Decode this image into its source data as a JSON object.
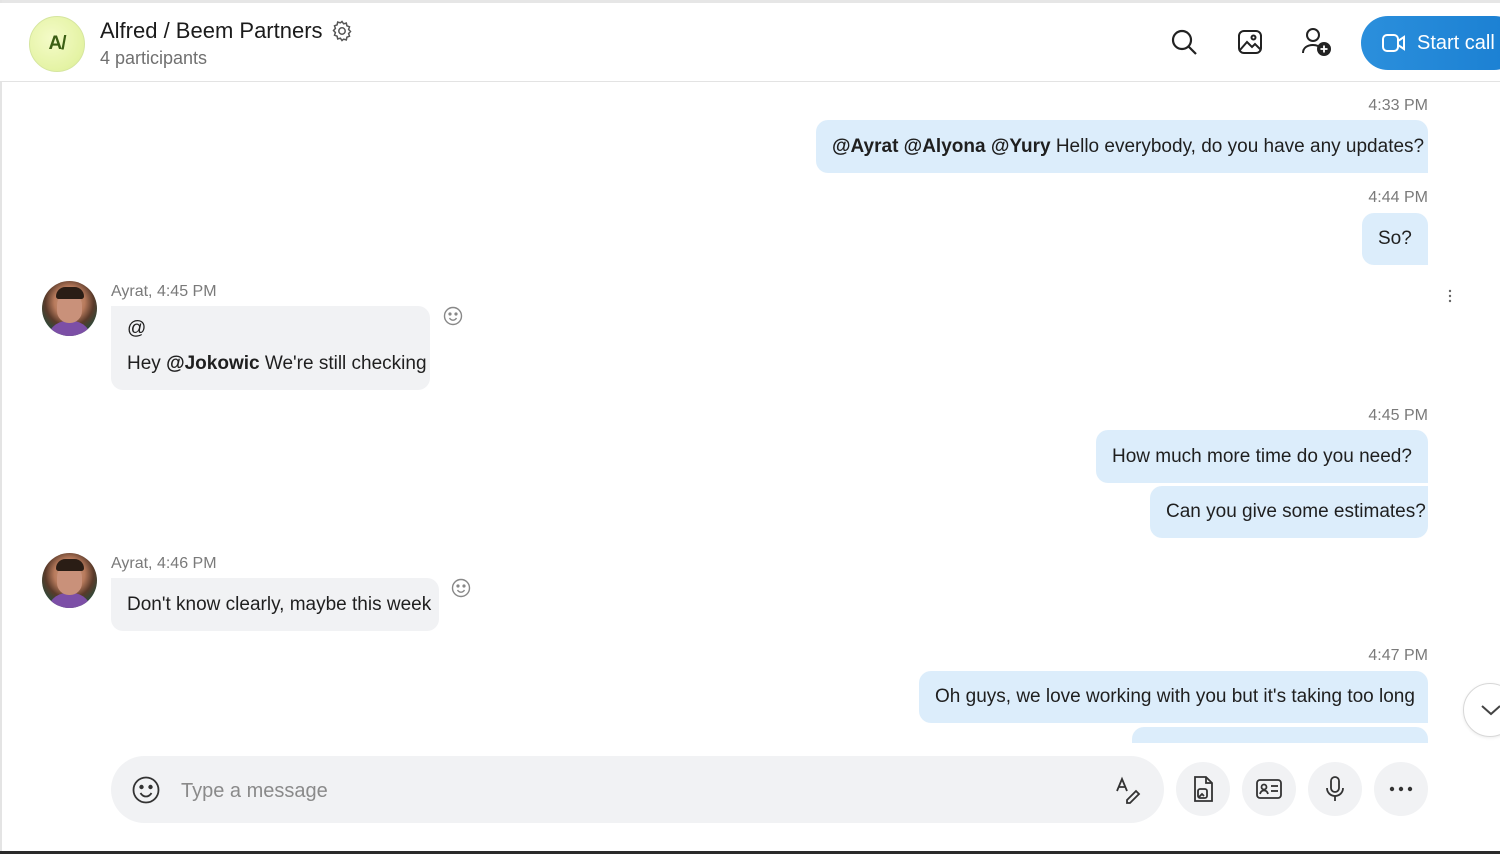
{
  "header": {
    "group_initials": "A/",
    "title": "Alfred / Beem Partners",
    "subtitle": "4 participants",
    "start_call_label": "Start call",
    "icons": [
      "gear-icon",
      "search-icon",
      "gallery-icon",
      "add-person-icon",
      "video-camera-icon"
    ]
  },
  "messages": [
    {
      "type": "outgoing",
      "time": "4:33 PM",
      "mentions": "@Ayrat @Alyona @Yury",
      "text": " Hello everybody, do you have any updates?"
    },
    {
      "type": "outgoing",
      "time": "4:44 PM",
      "text": "So?"
    },
    {
      "type": "incoming",
      "sender": "Ayrat, 4:45 PM",
      "line1": "@",
      "prefix": "Hey ",
      "mention": "@Jokowic",
      "text": " We're still checking"
    },
    {
      "type": "outgoing",
      "time": "4:45 PM",
      "text": "How much more time do you need?"
    },
    {
      "type": "outgoing",
      "text": "Can you give some estimates?"
    },
    {
      "type": "incoming",
      "sender": "Ayrat, 4:46 PM",
      "text": "Don't know clearly, maybe this week"
    },
    {
      "type": "outgoing",
      "time": "4:47 PM",
      "text": "Oh guys, we love working with you but it's taking too long"
    }
  ],
  "composer": {
    "placeholder": "Type a message",
    "icons": [
      "emoji-icon",
      "format-text-icon",
      "file-icon",
      "contact-card-icon",
      "microphone-icon",
      "more-options-icon"
    ]
  },
  "colors": {
    "accent": "#1a7fd2",
    "outgoing_bubble": "#dcedfb",
    "incoming_bubble": "#f1f2f4",
    "avatar_bg": "#e4f3a4"
  }
}
